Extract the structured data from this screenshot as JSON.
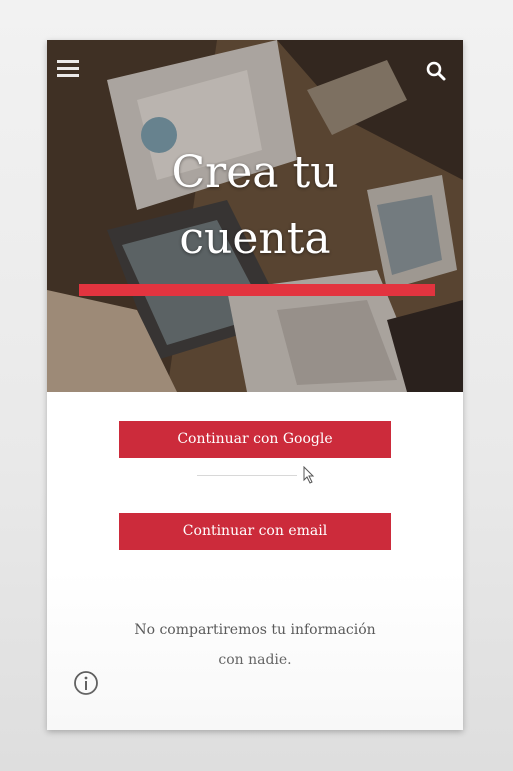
{
  "hero": {
    "title_line1": "Crea tu",
    "title_line2": "cuenta",
    "accent_color": "#e2343f",
    "menu_icon": "hamburger-menu-icon",
    "search_icon": "search-icon"
  },
  "actions": {
    "google_label": "Continuar con Google",
    "email_label": "Continuar con email",
    "button_color": "#cc2b3b"
  },
  "footer": {
    "privacy_line1": "No compartiremos tu información",
    "privacy_line2": "con nadie.",
    "info_icon": "info-icon"
  }
}
